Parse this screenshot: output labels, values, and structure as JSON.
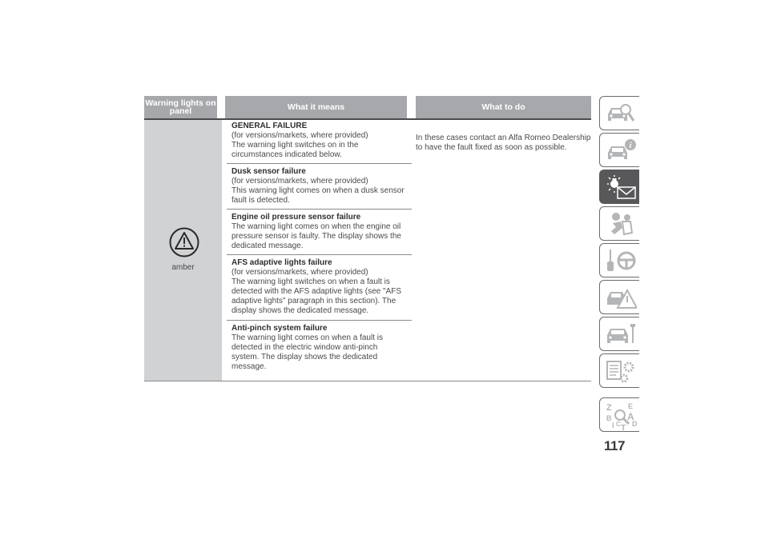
{
  "table": {
    "headers": {
      "col1": "Warning lights on panel",
      "col2": "What it means",
      "col3": "What to do"
    },
    "light_color_label": "amber",
    "icon": "warning-triangle-icon",
    "entries": [
      {
        "title": "GENERAL FAILURE",
        "lines": [
          "(for versions/markets, where provided)",
          "The warning light switches on in the",
          "circumstances indicated below."
        ]
      },
      {
        "title": "Dusk sensor failure",
        "lines": [
          "(for versions/markets, where provided)",
          "This warning light comes on when a dusk sensor",
          "fault is detected."
        ]
      },
      {
        "title": "Engine oil pressure sensor failure",
        "lines": [
          "The warning light comes on when the engine oil",
          "pressure sensor is faulty. The display shows the",
          "dedicated message."
        ]
      },
      {
        "title": "AFS adaptive lights failure",
        "lines": [
          "(for versions/markets, where provided)",
          "The warning light switches on when a fault is",
          "detected with the AFS adaptive lights (see \"AFS",
          "adaptive lights\" paragraph in this section). The",
          "display shows the dedicated message."
        ]
      },
      {
        "title": "Anti-pinch system failure",
        "lines": [
          "The warning light comes on when a fault is",
          "detected in the electric window anti-pinch",
          "system. The display shows the dedicated",
          "message."
        ]
      }
    ],
    "what_to_do": [
      "In these cases contact an Alfa Romeo Dealership",
      "to have the fault fixed as soon as possible."
    ]
  },
  "side_tabs": [
    {
      "icon": "car-magnifier-icon",
      "active": false
    },
    {
      "icon": "car-info-icon",
      "active": false
    },
    {
      "icon": "warning-light-message-icon",
      "active": true
    },
    {
      "icon": "airbag-seat-icon",
      "active": false
    },
    {
      "icon": "key-steering-wheel-icon",
      "active": false
    },
    {
      "icon": "car-accident-warning-icon",
      "active": false
    },
    {
      "icon": "car-wrench-icon",
      "active": false
    },
    {
      "icon": "document-gears-icon",
      "active": false
    },
    {
      "icon": "alphabetical-index-icon",
      "active": false
    }
  ],
  "colors": {
    "header_bg": "#a7a8ab",
    "col1_bg": "#d1d2d4",
    "active_tab": "#58585a"
  },
  "page_number": "117"
}
